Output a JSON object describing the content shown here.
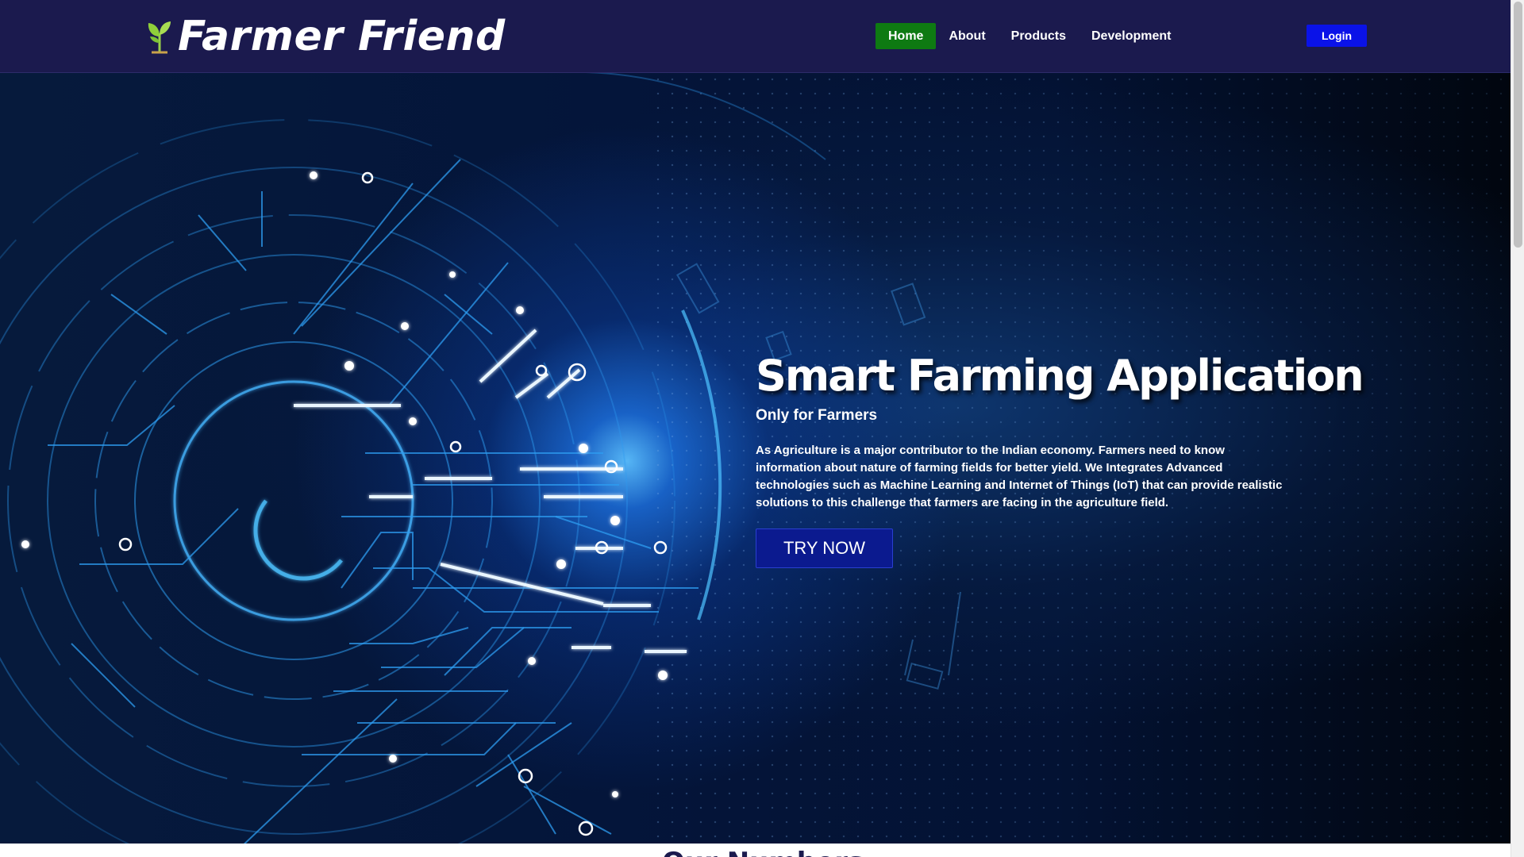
{
  "header": {
    "brand_name": "Farmer Friend",
    "logo_icon": "leaf-sprout-icon",
    "nav": [
      {
        "label": "Home",
        "active": true
      },
      {
        "label": "About",
        "active": false
      },
      {
        "label": "Products",
        "active": false
      },
      {
        "label": "Development",
        "active": false
      }
    ],
    "login_label": "Login"
  },
  "hero": {
    "title": "Smart Farming Application",
    "subtitle": "Only for Farmers",
    "description": "As Agriculture is a major contributor to the Indian economy. Farmers need to know information about nature of farming fields for better yield. We Integrates Advanced technologies such as Machine Learning and Internet of Things (IoT) that can provide realistic solutions to this challenge that farmers are facing in the agriculture field.",
    "cta_label": "TRY NOW",
    "background_art": "circuit-tech-illustration"
  },
  "next_section": {
    "heading": "Our Numbers"
  },
  "colors": {
    "nav_bg": "#1b1a4e",
    "active_nav": "#0e7a12",
    "login_button": "#0a12e8",
    "cta_button": "#0b1a8f",
    "brand_accent": "#8fcf3a",
    "circuit_line": "#3fb4ff"
  }
}
